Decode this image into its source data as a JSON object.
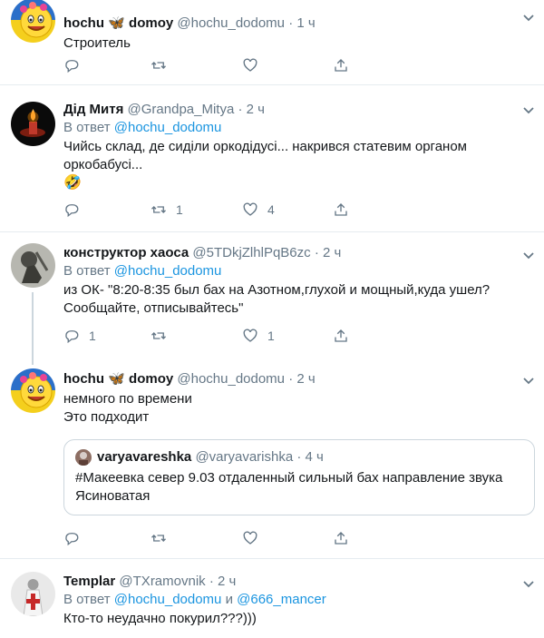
{
  "tweets": [
    {
      "name": "hochu",
      "name_butterfly": "🦋",
      "name_tail": "domoy",
      "handle": "@hochu_dodomu",
      "time": "1 ч",
      "text": "Строитель",
      "actions": {
        "reply": "",
        "retweet": "",
        "like": ""
      }
    },
    {
      "name": "Дід Митя",
      "handle": "@Grandpa_Mitya",
      "time": "2 ч",
      "reply_prefix": "В ответ",
      "reply_to": "@hochu_dodomu",
      "text_line1": "Чийсь склад, де сиділи оркодідусі... накрився статевим органом",
      "text_line2": "оркобабусі...",
      "emoji": "🤣",
      "actions": {
        "reply": "",
        "retweet": "1",
        "like": "4"
      }
    },
    {
      "name": "конструктор хаоса",
      "handle": "@5TDkjZlhlPqB6zc",
      "time": "2 ч",
      "reply_prefix": "В ответ",
      "reply_to": "@hochu_dodomu",
      "text_line1": "из ОК- \"8:20-8:35 был бах на Азотном,глухой и мощный,куда ушел?",
      "text_line2": "Сообщайте, отписывайтесь\"",
      "actions": {
        "reply": "1",
        "retweet": "",
        "like": "1"
      }
    },
    {
      "name": "hochu",
      "name_butterfly": "🦋",
      "name_tail": "domoy",
      "handle": "@hochu_dodomu",
      "time": "2 ч",
      "text_line1": "немного  по  времени",
      "text_line2": "Это  подходит",
      "quote": {
        "name": "varyavareshka",
        "handle": "@varyavarishka",
        "time": "4 ч",
        "text_line1": "#Макеевка север 9.03 отдаленный сильный бах направление звука",
        "text_line2": "Ясиноватая"
      },
      "actions": {
        "reply": "",
        "retweet": "",
        "like": ""
      }
    },
    {
      "name": "Templar",
      "handle": "@TXramovnik",
      "time": "2 ч",
      "reply_prefix": "В ответ",
      "reply_to": "@hochu_dodomu",
      "reply_and": "и",
      "reply_to2": "@666_mancer",
      "text": "Кто-то неудачно покурил???)))"
    }
  ],
  "dot": "·",
  "icons": [
    "reply-icon",
    "retweet-icon",
    "like-icon",
    "share-icon",
    "caret-down-icon"
  ],
  "colors": {
    "link": "#1b95e0",
    "muted": "#657786",
    "border": "#e6ecf0"
  }
}
